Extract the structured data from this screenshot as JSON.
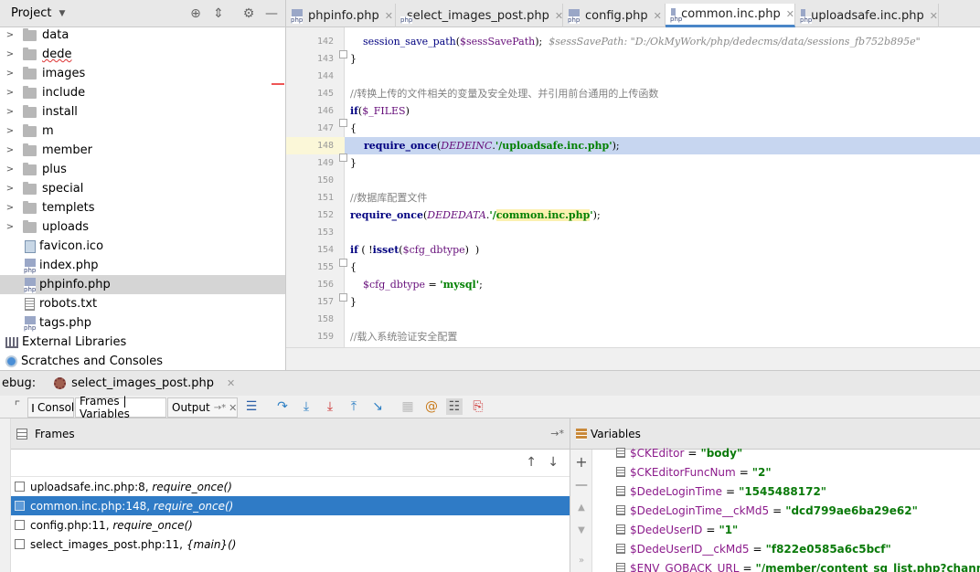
{
  "project": {
    "title": "Project",
    "items": [
      {
        "type": "folder",
        "label": "data"
      },
      {
        "type": "folder",
        "label": "dede",
        "squiggle": true
      },
      {
        "type": "folder",
        "label": "images"
      },
      {
        "type": "folder",
        "label": "include"
      },
      {
        "type": "folder",
        "label": "install"
      },
      {
        "type": "folder",
        "label": "m"
      },
      {
        "type": "folder",
        "label": "member"
      },
      {
        "type": "folder",
        "label": "plus"
      },
      {
        "type": "folder",
        "label": "special"
      },
      {
        "type": "folder",
        "label": "templets"
      },
      {
        "type": "folder",
        "label": "uploads"
      },
      {
        "type": "ico",
        "label": "favicon.ico"
      },
      {
        "type": "php",
        "label": "index.php"
      },
      {
        "type": "php",
        "label": "phpinfo.php",
        "selected": true
      },
      {
        "type": "txt",
        "label": "robots.txt"
      },
      {
        "type": "php",
        "label": "tags.php"
      },
      {
        "type": "lib",
        "label": "External Libraries"
      },
      {
        "type": "scr",
        "label": "Scratches and Consoles"
      }
    ]
  },
  "editor": {
    "tabs": [
      {
        "label": "phpinfo.php"
      },
      {
        "label": "select_images_post.php"
      },
      {
        "label": "config.php"
      },
      {
        "label": "common.inc.php",
        "active": true
      },
      {
        "label": "uploadsafe.inc.php"
      }
    ],
    "line_numbers": [
      "142",
      "143",
      "144",
      "145",
      "146",
      "147",
      "148",
      "149",
      "150",
      "151",
      "152",
      "153",
      "154",
      "155",
      "156",
      "157",
      "158",
      "159"
    ],
    "code": {
      "l142_fn": "session_save_path",
      "l142_open": "(",
      "l142_var": "$sessSavePath",
      "l142_close": ");",
      "l142_hint": "$sessSavePath: \"D:/OkMyWork/php/dedecms/data/sessions_fb752b895e\"",
      "l143": "}",
      "l145": "//转换上传的文件相关的变量及安全处理、并引用前台通用的上传函数",
      "l146_kw": "if",
      "l146_var": "$_FILES",
      "l146_close": ")",
      "l146_open": "(",
      "l147": "{",
      "l148_kw": "require_once",
      "l148_const": "DEDEINC",
      "l148_str": "'/uploadsafe.inc.php'",
      "l148_open": "(",
      "l148_dot": ".",
      "l148_close": ");",
      "l149": "}",
      "l151": "//数据库配置文件",
      "l152_kw": "require_once",
      "l152_const": "DEDEDATA",
      "l152_dot": ".",
      "l152_q1": "'/",
      "l152_str": "common.inc.php",
      "l152_q2": "'",
      "l152_open": "(",
      "l152_close": ");",
      "l154_kw": "if",
      "l154_open": " ( !",
      "l154_fn": "isset",
      "l154_var": "$cfg_dbtype",
      "l154_p": "(",
      "l154_close": ")  )",
      "l155": "{",
      "l156_var": "$cfg_dbtype",
      "l156_eq": " = ",
      "l156_str": "'mysql'",
      "l156_semi": ";",
      "l157": "}",
      "l159": "//载入系统验证安全配置"
    }
  },
  "debug": {
    "label": "ebug:",
    "session_tab": "select_images_post.php",
    "tabs": {
      "console": "Console",
      "frames_vars": "Frames | Variables",
      "output": "Output",
      "output_suffix": "→*"
    },
    "frames": {
      "title": "Frames",
      "items": [
        {
          "file": "uploadsafe.inc.php:8,",
          "ctx": "require_once()"
        },
        {
          "file": "common.inc.php:148,",
          "ctx": "require_once()",
          "selected": true
        },
        {
          "file": "config.php:11,",
          "ctx": "require_once()"
        },
        {
          "file": "select_images_post.php:11,",
          "ctx": "{main}()"
        }
      ]
    },
    "variables": {
      "title": "Variables",
      "items": [
        {
          "name": "$CKEditor",
          "value": "\"body\""
        },
        {
          "name": "$CKEditorFuncNum",
          "value": "\"2\""
        },
        {
          "name": "$DedeLoginTime",
          "value": "\"1545488172\""
        },
        {
          "name": "$DedeLoginTime__ckMd5",
          "value": "\"dcd799ae6ba29e62\""
        },
        {
          "name": "$DedeUserID",
          "value": "\"1\""
        },
        {
          "name": "$DedeUserID__ckMd5",
          "value": "\"f822e0585a6c5bcf\""
        },
        {
          "name": "$ENV_GOBACK_URL",
          "value": "\"/member/content_sg_list.php?channelid"
        }
      ]
    }
  },
  "colors": {
    "selection": "#2f7bc6",
    "line_highlight": "#c7d6f0",
    "keyword": "#000080",
    "string": "#008000",
    "variable": "#660e7a"
  }
}
